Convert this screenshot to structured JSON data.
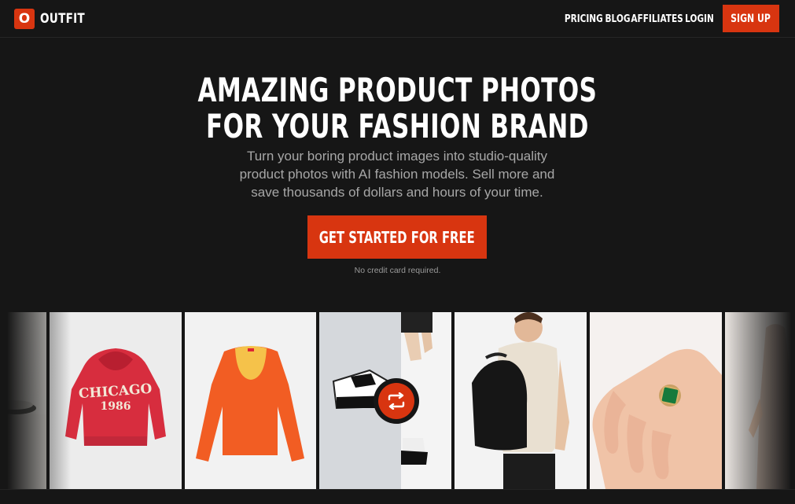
{
  "header": {
    "logo_letter": "O",
    "logo_text": "OUTFIT",
    "nav": [
      "PRICING",
      "BLOG",
      "AFFILIATES",
      "LOGIN"
    ],
    "signup_label": "SIGN UP"
  },
  "hero": {
    "title_line1": "AMAZING PRODUCT PHOTOS",
    "title_line2": "FOR YOUR FASHION BRAND",
    "subtitle_line1": "Turn your boring product images into studio-quality",
    "subtitle_line2": "product photos with AI fashion models. Sell more and",
    "subtitle_line3": "save thousands of dollars and hours of your time.",
    "cta_label": "GET STARTED FOR FREE",
    "note": "No credit card required."
  },
  "gallery": {
    "hoodie_text_1": "CHICAGO",
    "hoodie_text_2": "1986",
    "icons": [
      "swap-icon"
    ]
  },
  "colors": {
    "background": "#161616",
    "accent": "#d83510",
    "muted_text": "#a7a7a7"
  }
}
